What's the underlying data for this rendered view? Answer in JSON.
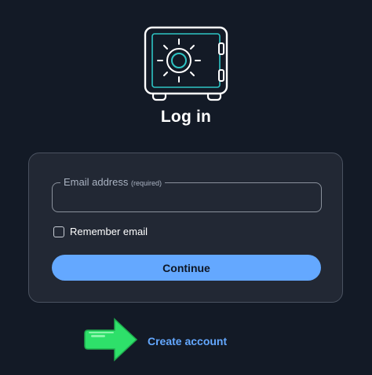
{
  "header": {
    "logo_icon": "vault-safe-icon",
    "title": "Log in"
  },
  "form": {
    "email_label": "Email address",
    "email_required_hint": "(required)",
    "email_value": "",
    "remember_label": "Remember email",
    "remember_checked": false,
    "continue_label": "Continue"
  },
  "footer": {
    "pointer_icon": "green-arrow-icon",
    "create_account_label": "Create account"
  },
  "colors": {
    "background": "#131a26",
    "card": "#222834",
    "accent": "#64a8ff",
    "logo_accent": "#2ec4c4",
    "arrow": "#2ee06a"
  }
}
